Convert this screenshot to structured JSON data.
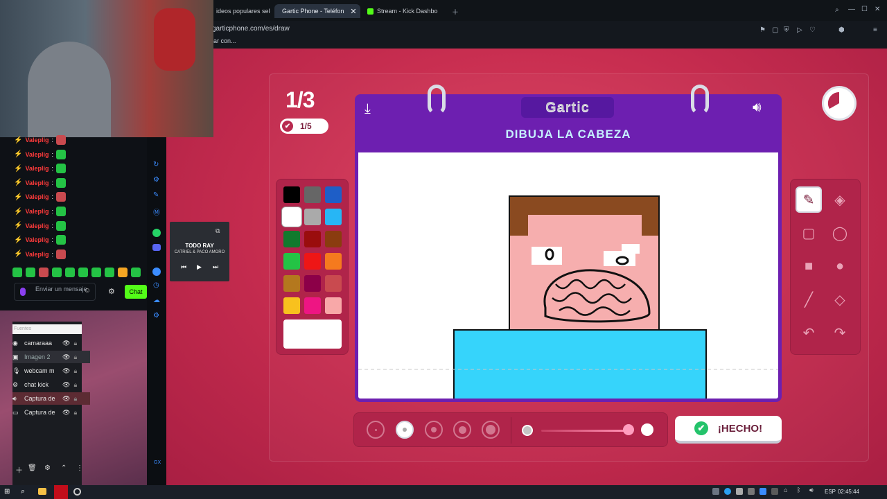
{
  "browser": {
    "tabs": [
      {
        "label": "ideos populares sele"
      },
      {
        "label": "Gartic Phone - Teléfon",
        "active": true
      },
      {
        "label": "Stream - Kick Dashbo"
      }
    ],
    "url": "garticphone.com/es/draw",
    "subtext": "ar con..."
  },
  "game": {
    "round": "1/3",
    "turn": "1/5",
    "logo": "Gartic",
    "prompt": "DIBUJA LA CABEZA",
    "done_label": "¡HECHO!",
    "colors": [
      "#000000",
      "#666666",
      "#1e5ec7",
      "#ffffff",
      "#aaaaaa",
      "#27b6f5",
      "#117a2d",
      "#9a0d0d",
      "#8a3c0f",
      "#24c345",
      "#ee1616",
      "#f57a1e",
      "#b4781e",
      "#8c0048",
      "#c94a4f",
      "#f8c11e",
      "#ee1583",
      "#f8a8a8"
    ],
    "selected_color": "#ffffff",
    "tools": [
      "pencil-icon",
      "fill-bucket-icon",
      "rectangle-outline-icon",
      "ellipse-outline-icon",
      "rectangle-filled-icon",
      "ellipse-filled-icon",
      "line-icon",
      "fill-outline-icon",
      "undo-icon",
      "redo-icon"
    ],
    "selected_tool": "pencil-icon",
    "brush_size_selected": 2
  },
  "overlay": {
    "chat_user": "Valeplig",
    "chat_messages": 9,
    "message_placeholder": "Enviar un mensaje",
    "chat_button": "Chat",
    "music_title": "TODO RAY",
    "music_artist": "CATRIEL & PACO AMORO",
    "sources_header": "Fuentes",
    "sources": [
      {
        "label": "camaraaa"
      },
      {
        "label": "Imagen 2"
      },
      {
        "label": "webcam m"
      },
      {
        "label": "chat kick"
      },
      {
        "label": "Captura de"
      },
      {
        "label": "Captura de"
      }
    ]
  },
  "taskbar": {
    "lang": "ESP",
    "clock": "02:45:44"
  }
}
